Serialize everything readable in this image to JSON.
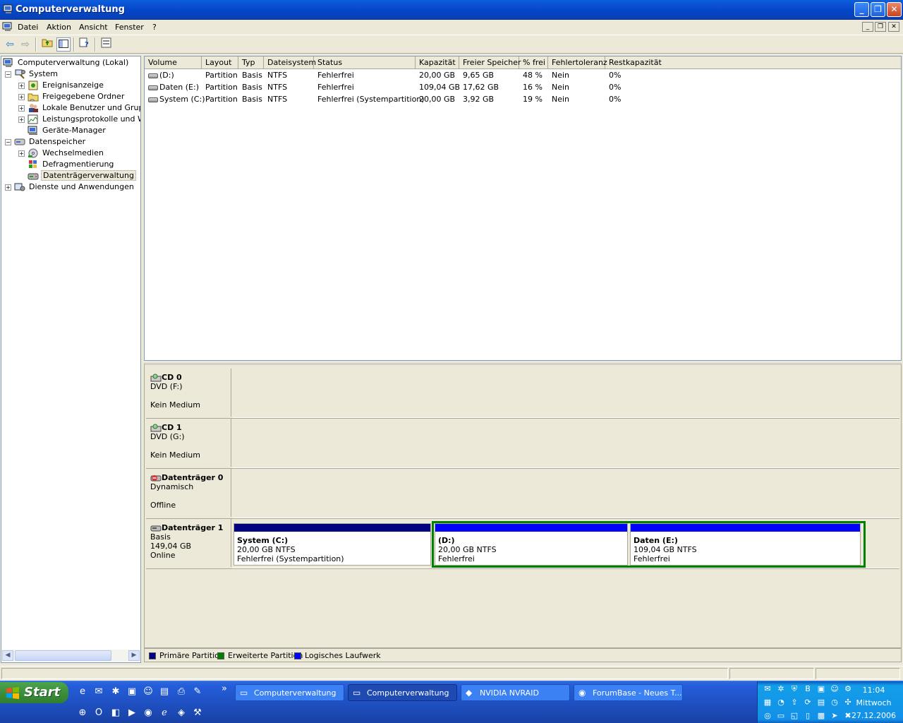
{
  "window": {
    "title": "Computerverwaltung"
  },
  "menu": [
    "Datei",
    "Aktion",
    "Ansicht",
    "Fenster",
    "?"
  ],
  "tree": {
    "root": "Computerverwaltung (Lokal)",
    "system": "System",
    "events": "Ereignisanzeige",
    "shared": "Freigegebene Ordner",
    "users": "Lokale Benutzer und Gruppen",
    "perf": "Leistungsprotokolle und Warnungen",
    "devmgr": "Geräte-Manager",
    "storage": "Datenspeicher",
    "removable": "Wechselmedien",
    "defrag": "Defragmentierung",
    "diskmgmt": "Datenträgerverwaltung",
    "services": "Dienste und Anwendungen"
  },
  "volumes": {
    "columns": [
      "Volume",
      "Layout",
      "Typ",
      "Dateisystem",
      "Status",
      "Kapazität",
      "Freier Speicher",
      "% frei",
      "Fehlertoleranz",
      "Restkapazität"
    ],
    "rows": [
      [
        "(D:)",
        "Partition",
        "Basis",
        "NTFS",
        "Fehlerfrei",
        "20,00 GB",
        "9,65 GB",
        "48 %",
        "Nein",
        "0%"
      ],
      [
        "Daten (E:)",
        "Partition",
        "Basis",
        "NTFS",
        "Fehlerfrei",
        "109,04 GB",
        "17,62 GB",
        "16 %",
        "Nein",
        "0%"
      ],
      [
        "System (C:)",
        "Partition",
        "Basis",
        "NTFS",
        "Fehlerfrei (Systempartition)",
        "20,00 GB",
        "3,92 GB",
        "19 %",
        "Nein",
        "0%"
      ]
    ]
  },
  "disks": {
    "cd0": {
      "name": "CD 0",
      "type": "DVD (F:)",
      "status": "Kein Medium"
    },
    "cd1": {
      "name": "CD 1",
      "type": "DVD (G:)",
      "status": "Kein Medium"
    },
    "disk0": {
      "name": "Datenträger 0",
      "type": "Dynamisch",
      "status": "Offline"
    },
    "disk1": {
      "name": "Datenträger 1",
      "type": "Basis",
      "size": "149,04 GB",
      "status": "Online",
      "partitions": [
        {
          "name": "System  (C:)",
          "size": "20,00 GB NTFS",
          "status": "Fehlerfrei (Systempartition)"
        },
        {
          "name": "(D:)",
          "size": "20,00 GB NTFS",
          "status": "Fehlerfrei"
        },
        {
          "name": "Daten  (E:)",
          "size": "109,04 GB NTFS",
          "status": "Fehlerfrei"
        }
      ]
    }
  },
  "legend": {
    "primary": "Primäre Partition",
    "extended": "Erweiterte Partition",
    "logical": "Logisches Laufwerk"
  },
  "colors": {
    "primary": "#000080",
    "extended": "#008000",
    "logical": "#0000FF"
  },
  "taskbar": {
    "start": "Start",
    "tasks": [
      "Computerverwaltung",
      "Computerverwaltung",
      "NVIDIA NVRAID",
      "ForumBase - Neues T..."
    ],
    "clock": {
      "time": "11:04",
      "day": "Mittwoch",
      "date": "27.12.2006"
    }
  }
}
